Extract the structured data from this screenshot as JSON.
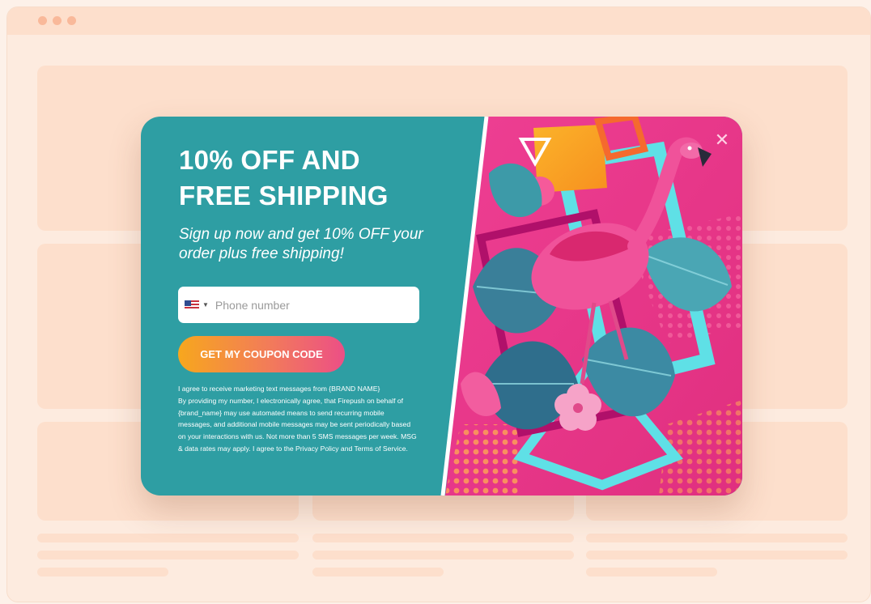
{
  "popup": {
    "headline_line1": "10% OFF AND",
    "headline_line2": "FREE SHIPPING",
    "subtext": "Sign up now and get 10% OFF your order plus free shipping!",
    "phone": {
      "placeholder": "Phone number",
      "value": "",
      "country_icon": "us-flag-icon"
    },
    "cta_label": "GET MY COUPON CODE",
    "legal_lines": [
      "I agree to receive marketing text messages from {BRAND NAME}",
      "By providing my number, I electronically agree, that Firepush on behalf of",
      "{brand_name} may use automated means to send recurring mobile",
      "messages, and additional mobile messages may be sent periodically based",
      "on your interactions with us. Not more than 5 SMS messages per week. MSG",
      "& data rates may apply. I agree to the Privacy Policy and Terms of Service."
    ],
    "close_icon": "close-icon"
  },
  "colors": {
    "teal": "#2e9ea3",
    "pink": "#e8388b",
    "orange": "#f7a71d",
    "page_bg": "#fdebdf"
  }
}
